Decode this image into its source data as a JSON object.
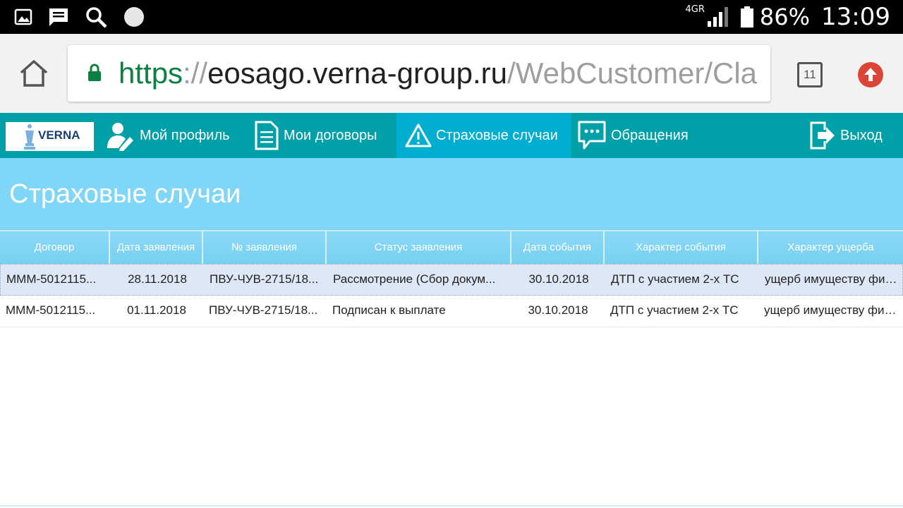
{
  "status_bar": {
    "network": "4GR",
    "battery": "86%",
    "time": "13:09"
  },
  "browser": {
    "url_scheme": "https",
    "url_sep": "://",
    "url_host": "eosago.verna-group.ru",
    "url_path": "/WebCustomer/Cla",
    "tab_count": "11"
  },
  "nav": {
    "logo": "VERNA",
    "items": [
      {
        "label": "Мой профиль"
      },
      {
        "label": "Мои договоры"
      },
      {
        "label": "Страховые случаи"
      },
      {
        "label": "Обращения"
      }
    ],
    "logout": "Выход"
  },
  "page": {
    "title": "Страховые случаи"
  },
  "table": {
    "columns": [
      "Договор",
      "Дата заявления",
      "№ заявления",
      "Статус заявления",
      "Дата события",
      "Характер события",
      "Характер ущерба"
    ],
    "rows": [
      [
        "МММ-5012115...",
        "28.11.2018",
        "ПВУ-ЧУВ-2715/18...",
        "Рассмотрение (Сбор докум...",
        "30.10.2018",
        "ДТП с участием 2-х ТС",
        "ущерб имуществу физ..."
      ],
      [
        "МММ-5012115...",
        "01.11.2018",
        "ПВУ-ЧУВ-2715/18...",
        "Подписан к выплате",
        "30.10.2018",
        "ДТП с участием 2-х ТС",
        "ущерб имуществу физ..."
      ]
    ]
  },
  "colors": {
    "nav_bg": "#00a0a8",
    "nav_active": "#00aed0",
    "title_band": "#80d6f6",
    "url_green": "#0b8043"
  }
}
